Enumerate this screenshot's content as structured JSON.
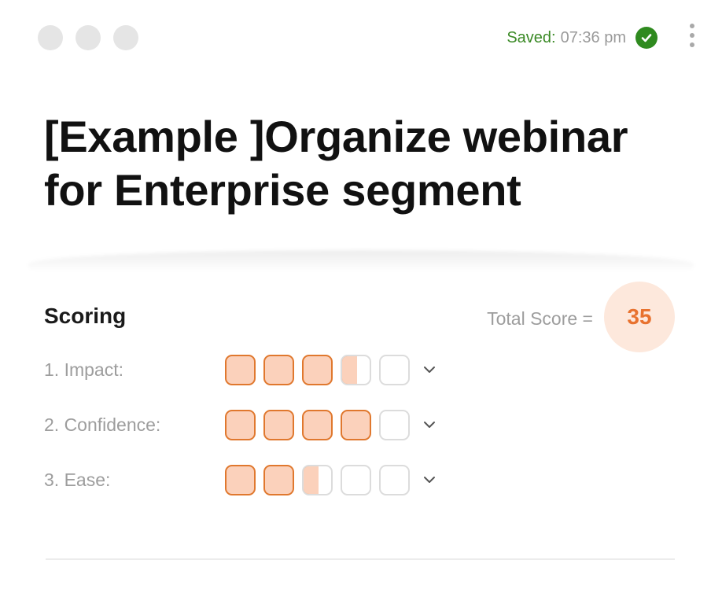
{
  "header": {
    "saved_label": "Saved",
    "saved_time": "07:36 pm"
  },
  "title": "[Example ]Organize webinar for Enterprise segment",
  "scoring": {
    "heading": "Scoring",
    "total_label": "Total Score =",
    "total_value": "35",
    "criteria": [
      {
        "label": "1. Impact:",
        "score": 3.5,
        "max": 5
      },
      {
        "label": "2. Confidence:",
        "score": 4,
        "max": 5
      },
      {
        "label": "3. Ease:",
        "score": 2.5,
        "max": 5
      }
    ]
  },
  "colors": {
    "accent": "#e8722f",
    "accent_fill": "#fbd1bb",
    "saved_green": "#3b8a26",
    "badge_bg": "#fde8dc"
  },
  "icons": {
    "saved_status": "check-circle-icon",
    "menu": "kebab-menu-icon",
    "dropdown": "chevron-down-icon"
  }
}
